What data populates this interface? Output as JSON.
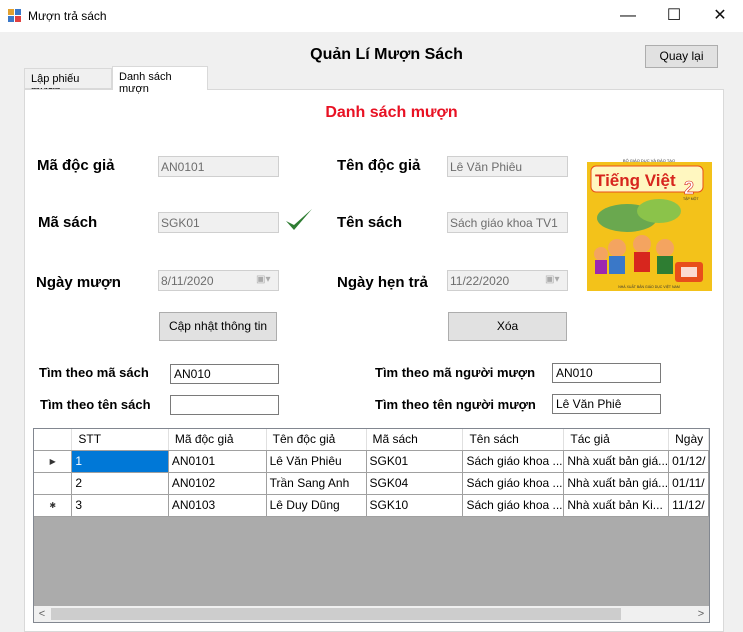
{
  "window": {
    "title": "Mượn trả sách",
    "minimize": "—",
    "maximize": "☐",
    "close": "✕"
  },
  "header": {
    "title": "Quản Lí Mượn Sách",
    "back_button": "Quay lại"
  },
  "tabs": [
    {
      "label": "Lập phiếu mượn",
      "active": false
    },
    {
      "label": "Danh sách mượn",
      "active": true
    }
  ],
  "section_title": "Danh sách mượn",
  "form": {
    "reader_id": {
      "label": "Mã độc giả",
      "value": "AN0101"
    },
    "reader_name": {
      "label": "Tên độc giả",
      "value": "Lê Văn Phiêu"
    },
    "book_id": {
      "label": "Mã sách",
      "value": "SGK01"
    },
    "book_name": {
      "label": "Tên sách",
      "value": "Sách giáo khoa TV1"
    },
    "borrow_date": {
      "label": "Ngày mượn",
      "value": "8/11/2020"
    },
    "due_date": {
      "label": "Ngày hẹn trả",
      "value": "11/22/2020"
    },
    "update_button": "Cập nhật thông tin",
    "delete_button": "Xóa"
  },
  "book_cover": {
    "publisher": "BỘ GIÁO DỤC VÀ ĐÀO TẠO",
    "title": "Tiếng Việt",
    "grade": "2",
    "volume": "TẬP MỘT",
    "footer": "NHÀ XUẤT BẢN GIÁO DỤC VIỆT NAM",
    "colors": {
      "bg": "#f3c21a",
      "title": "#d7261e",
      "accent": "#e84e1b"
    }
  },
  "search": {
    "by_book_id": {
      "label": "Tìm theo mã sách",
      "value": "AN010"
    },
    "by_book_name": {
      "label": "Tìm theo tên sách",
      "value": ""
    },
    "by_borrower_id": {
      "label": "Tìm theo mã người mượn",
      "value": "AN010"
    },
    "by_borrower_name": {
      "label": "Tìm theo tên người mượn",
      "value": "Lê Văn Phiê"
    }
  },
  "grid": {
    "columns": [
      "STT",
      "Mã độc giả",
      "Tên độc giả",
      "Mã sách",
      "Tên sách",
      "Tác giả",
      "Ngày"
    ],
    "rows": [
      {
        "indicator": "▶",
        "cells": [
          "1",
          "AN0101",
          "Lê Văn Phiêu",
          "SGK01",
          "Sách giáo khoa ...",
          "Nhà xuất bản giá...",
          "01/12/"
        ]
      },
      {
        "indicator": "",
        "cells": [
          "2",
          "AN0102",
          "Trần Sang Anh",
          "SGK04",
          "Sách giáo khoa ...",
          "Nhà xuất bản giá...",
          "01/11/"
        ]
      },
      {
        "indicator": "✱",
        "cells": [
          "3",
          "AN0103",
          "Lê Duy Dũng",
          "SGK10",
          "Sách giáo khoa ...",
          "Nhà xuất bản Ki...",
          "11/12/"
        ]
      }
    ],
    "scroll_left": "<",
    "scroll_right": ">"
  },
  "colors": {
    "section_title": "#e81123",
    "selection": "#0078d7",
    "check": "#2e7d32"
  }
}
